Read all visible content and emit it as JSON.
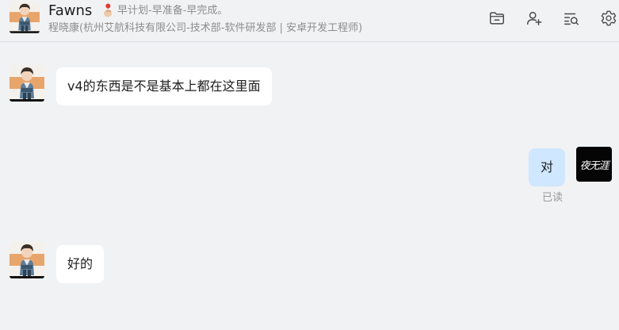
{
  "header": {
    "contact_name": "Fawns",
    "status_text": "早计划-早准备-早完成。",
    "org_text": "程晓康(杭州艾航科技有限公司-技术部-软件研发部 | 安卓开发工程师)",
    "toolbar": {
      "files_icon": "folder-icon",
      "add_member_icon": "add-user-icon",
      "search_history_icon": "search-list-icon",
      "settings_icon": "gear-icon"
    }
  },
  "messages": [
    {
      "sender": "contact",
      "text": "v4的东西是不是基本上都在这里面"
    },
    {
      "sender": "self",
      "text": "对",
      "status": "已读"
    },
    {
      "sender": "contact",
      "text": "好的"
    }
  ],
  "self_avatar_text": "夜无涯",
  "colors": {
    "background": "#f1f2f4",
    "bubble_other": "#ffffff",
    "bubble_self": "#cfe7ff",
    "secondary_text": "#8d8d8d",
    "icon": "#4a4a4a"
  }
}
